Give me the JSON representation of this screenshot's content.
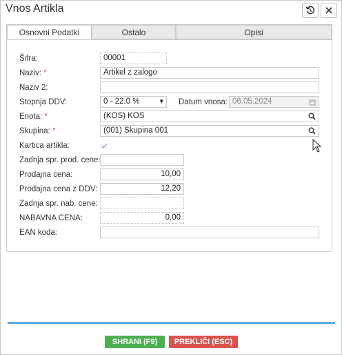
{
  "dialog": {
    "title": "Vnos Artikla",
    "history_icon": "history-icon",
    "close_icon": "close-icon"
  },
  "tabs": [
    {
      "label": "Osnovni Podatki",
      "active": true
    },
    {
      "label": "Ostalo",
      "active": false
    },
    {
      "label": "Opisi",
      "active": false
    }
  ],
  "form": {
    "sifra": {
      "label": "Šifra:",
      "value": "00001"
    },
    "naziv": {
      "label": "Naziv:",
      "required": "*",
      "value": "Artikel z zalogo"
    },
    "naziv2": {
      "label": "Naziv 2:",
      "value": ""
    },
    "stopnja_ddv": {
      "label": "Stopnja DDV:",
      "value": "0 - 22.0 %"
    },
    "datum_vnosa": {
      "label": "Datum vnosa:",
      "value": "06.05.2024"
    },
    "enota": {
      "label": "Enota:",
      "required": "*",
      "value": "(KOS) KOS"
    },
    "skupina": {
      "label": "Skupina:",
      "required": "*",
      "value": "(001) Skupina 001"
    },
    "kartica_artikla": {
      "label": "Kartica artikla:",
      "checked": true
    },
    "zadnja_spr_prod_cene": {
      "label": "Zadnja spr. prod. cene:",
      "value": ""
    },
    "prodajna_cena": {
      "label": "Prodajna cena:",
      "value": "10,00"
    },
    "prodajna_cena_ddv": {
      "label": "Prodajna cena z DDV:",
      "value": "12,20"
    },
    "zadnja_spr_nab_cene": {
      "label": "Zadnja spr. nab. cene:",
      "value": ""
    },
    "nabavna_cena": {
      "label": "NABAVNA CENA:",
      "value": "0,00"
    },
    "ean_koda": {
      "label": "EAN koda:",
      "value": ""
    }
  },
  "buttons": {
    "save": "SHRANI (F9)",
    "cancel": "PREKLIČI (ESC)"
  },
  "colors": {
    "save": "#4caf50",
    "cancel": "#d9534f",
    "accent_bar": "#5da9e0",
    "required": "#d9534f"
  }
}
